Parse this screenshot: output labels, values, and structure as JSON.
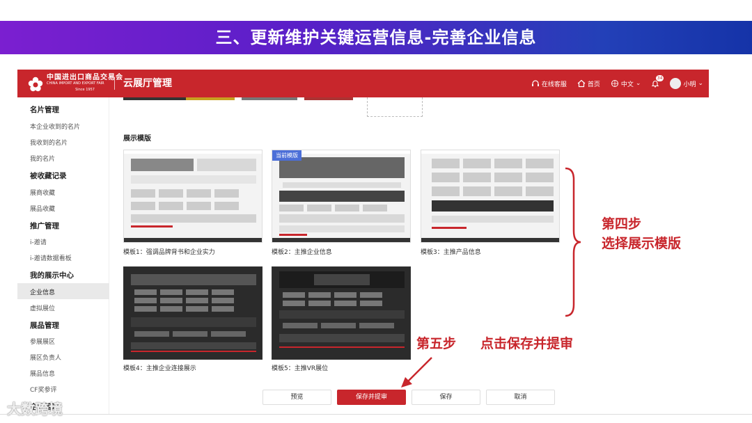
{
  "banner": {
    "title": "三、更新维护关键运营信息-完善企业信息"
  },
  "topbar": {
    "logo_cn": "中国进出口商品交易会",
    "logo_en": "CHINA IMPORT AND EXPORT FAIR",
    "logo_since": "Since 1957",
    "app_title": "云展厅管理",
    "support": "在线客服",
    "home": "首页",
    "language": "中文",
    "notif_count": "34",
    "user": "小明"
  },
  "sidebar": {
    "sections": [
      {
        "title": "名片管理",
        "items": [
          "本企业收到的名片",
          "我收到的名片",
          "我的名片"
        ]
      },
      {
        "title": "被收藏记录",
        "items": [
          "展商收藏",
          "展品收藏"
        ]
      },
      {
        "title": "推广管理",
        "items": [
          "i-邀请",
          "i-邀请数据看板"
        ]
      },
      {
        "title": "我的展示中心",
        "items": [
          "企业信息",
          "虚拟展位"
        ]
      },
      {
        "title": "展品管理",
        "items": [
          "参展展区",
          "展区负责人",
          "展品信息",
          "CF奖参评"
        ]
      },
      {
        "title": "企业管理",
        "items": []
      }
    ],
    "active_item": "企业信息"
  },
  "main": {
    "section_title": "展示模版",
    "current_tag": "当前模版",
    "templates": [
      {
        "caption": "模板1：强调品牌背书和企业实力",
        "theme": "light"
      },
      {
        "caption": "模板2：主推企业信息",
        "theme": "light",
        "current": true
      },
      {
        "caption": "模板3：主推产品信息",
        "theme": "light"
      },
      {
        "caption": "模板4：主推企业连接展示",
        "theme": "dark"
      },
      {
        "caption": "模板5：主推VR展位",
        "theme": "dark"
      }
    ],
    "buttons": {
      "preview": "预览",
      "save_submit": "保存并提审",
      "save": "保存",
      "cancel": "取消"
    }
  },
  "annotations": {
    "step4_line1": "第四步",
    "step4_line2": "选择展示模版",
    "step5": "第五步",
    "step5_action": "点击保存并提审"
  },
  "watermark": "大数跨境",
  "colors": {
    "brand_red": "#c8262c",
    "banner_start": "#7b1fd0",
    "banner_end": "#1533a8",
    "current_tag": "#4c6fd8",
    "annotation": "#c8262c"
  }
}
